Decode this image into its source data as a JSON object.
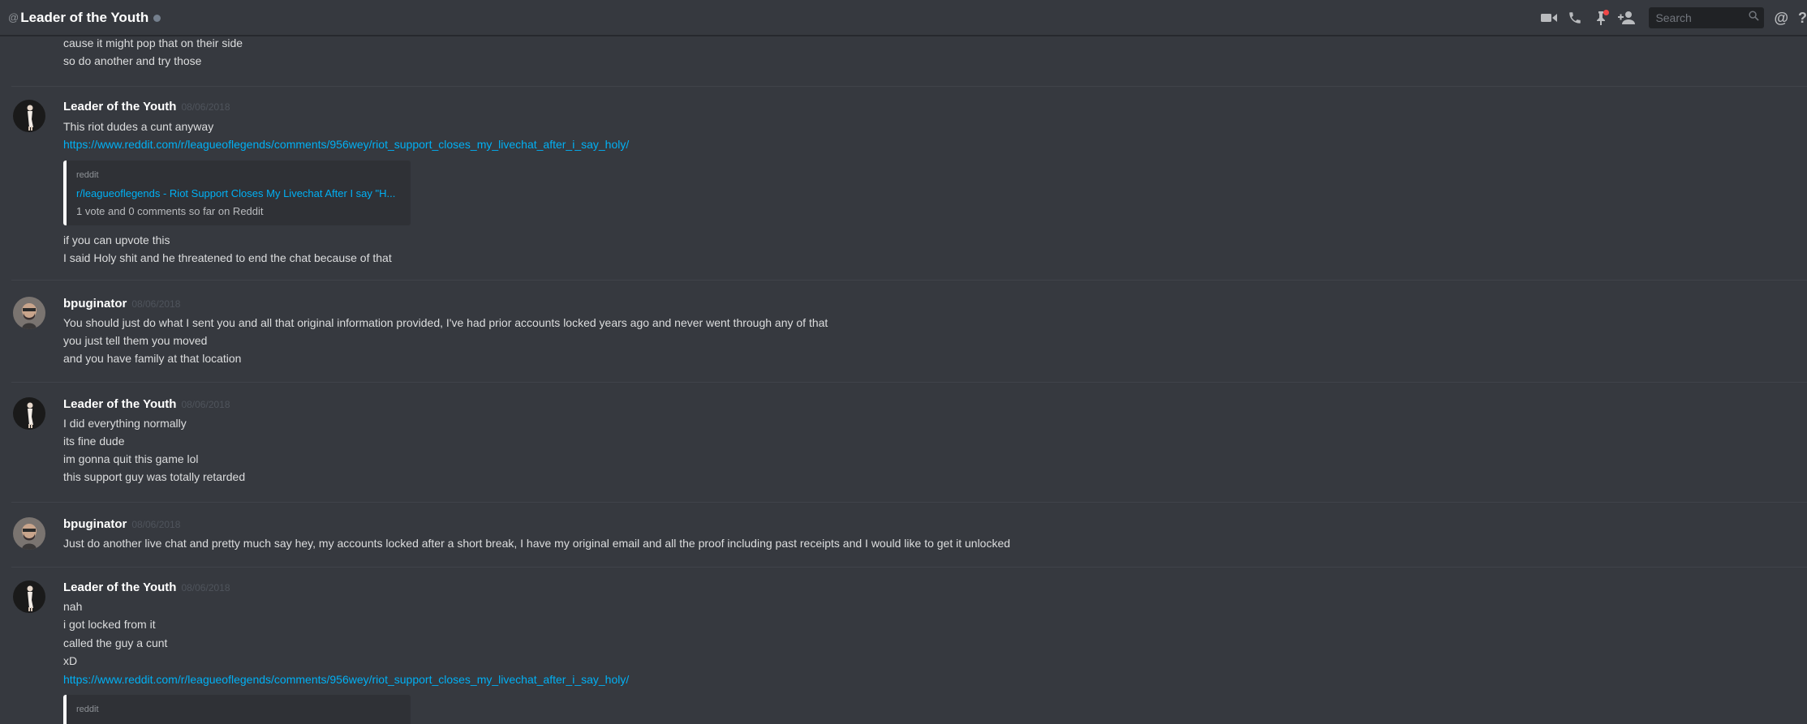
{
  "header": {
    "at_symbol": "@",
    "channel_title": "Leader of the Youth",
    "search_placeholder": "Search",
    "mentions_symbol": "@",
    "help_symbol": "?"
  },
  "icons": {
    "video": "video-camera-icon",
    "call": "phone-icon",
    "pinned": "pin-icon",
    "add_friend": "add-member-icon",
    "search": "magnifier-icon"
  },
  "colors": {
    "background": "#36393f",
    "link": "#00b0f4",
    "notification": "#f04747"
  },
  "messages": {
    "top_lines": [
      "cause it might pop that on their side",
      "so do another and try those"
    ],
    "m1": {
      "author": "Leader of the Youth",
      "time": "08/06/2018",
      "lines": [
        "This riot dudes a cunt anyway"
      ],
      "link": "https://www.reddit.com/r/leagueoflegends/comments/956wey/riot_support_closes_my_livechat_after_i_say_holy/",
      "embed": {
        "provider": "reddit",
        "title": "r/leagueoflegends - Riot Support Closes My Livechat After I say \"H...",
        "description": "1 vote and 0 comments so far on Reddit"
      },
      "after_lines": [
        "if you can upvote this",
        "I said Holy shit and he threatened to end the chat because of that"
      ]
    },
    "m2": {
      "author": "bpuginator",
      "time": "08/06/2018",
      "lines": [
        "You should just do what I sent you and all that original information provided, I've had prior accounts locked years ago and never went through any of that",
        "you just tell them you moved",
        "and you have family at that location"
      ]
    },
    "m3": {
      "author": "Leader of the Youth",
      "time": "08/06/2018",
      "lines": [
        "I did everything normally",
        "its fine dude",
        "im gonna quit this game lol",
        "this support guy was totally retarded"
      ]
    },
    "m4": {
      "author": "bpuginator",
      "time": "08/06/2018",
      "lines": [
        "Just do another live chat and pretty much say hey, my accounts locked after a short break, I have my original email and all the proof including past receipts and I would like to get it unlocked"
      ]
    },
    "m5": {
      "author": "Leader of the Youth",
      "time": "08/06/2018",
      "lines": [
        "nah",
        "i got locked from it",
        "called the guy a cunt",
        "xD"
      ],
      "link": "https://www.reddit.com/r/leagueoflegends/comments/956wey/riot_support_closes_my_livechat_after_i_say_holy/",
      "embed": {
        "provider": "reddit"
      }
    }
  }
}
